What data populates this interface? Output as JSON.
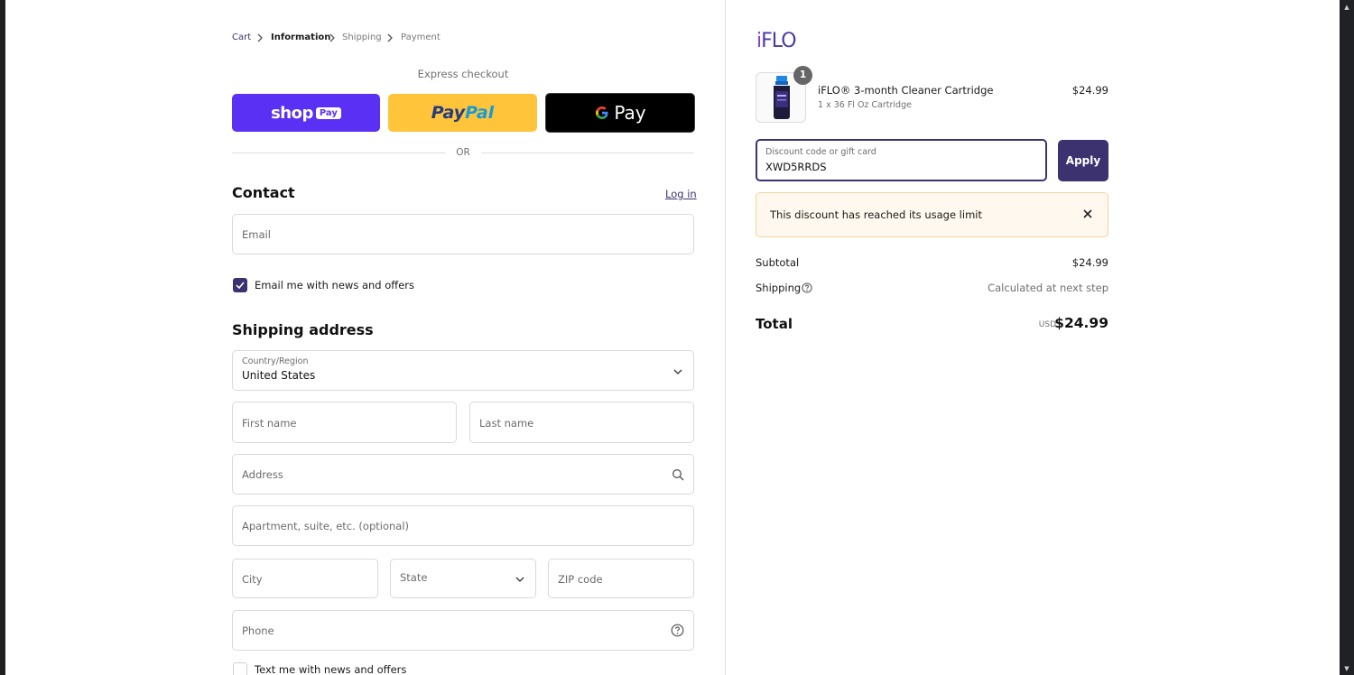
{
  "breadcrumb": {
    "cart": "Cart",
    "information": "Information",
    "shipping": "Shipping",
    "payment": "Payment"
  },
  "express": {
    "label": "Express checkout",
    "shop_pay": {
      "word": "shop",
      "badge": "Pay"
    },
    "paypal": {
      "pay": "Pay",
      "pal": "Pal"
    },
    "gpay": {
      "g": "G",
      "word": "Pay"
    },
    "or": "OR"
  },
  "contact": {
    "title": "Contact",
    "login": "Log in",
    "email_placeholder": "Email",
    "newsletter_label": "Email me with news and offers",
    "newsletter_checked": true
  },
  "shipping_address": {
    "title": "Shipping address",
    "country_label": "Country/Region",
    "country_value": "United States",
    "first_name": "First name",
    "last_name": "Last name",
    "address": "Address",
    "apartment": "Apartment, suite, etc. (optional)",
    "city": "City",
    "state": "State",
    "zip": "ZIP code",
    "phone": "Phone",
    "sms_label": "Text me with news and offers",
    "sms_checked": false
  },
  "summary": {
    "logo": {
      "i": "i",
      "flo": "FLO"
    },
    "item": {
      "quantity": "1",
      "name": "iFLO® 3-month Cleaner Cartridge",
      "variant": "1 x 36 Fl Oz Cartridge",
      "price": "$24.99"
    },
    "discount": {
      "label": "Discount code or gift card",
      "value": "XWD5RRDS",
      "apply": "Apply",
      "error": "This discount has reached its usage limit"
    },
    "subtotal_label": "Subtotal",
    "subtotal_value": "$24.99",
    "shipping_label": "Shipping",
    "shipping_value": "Calculated at next step",
    "total_label": "Total",
    "total_currency": "USD",
    "total_value": "$24.99"
  },
  "colors": {
    "accent": "#3d3270",
    "shop_pay": "#5a31f4",
    "paypal": "#ffc439",
    "gpay": "#000000",
    "notice_bg": "#fff8ee",
    "notice_border": "#f2d3a2"
  }
}
